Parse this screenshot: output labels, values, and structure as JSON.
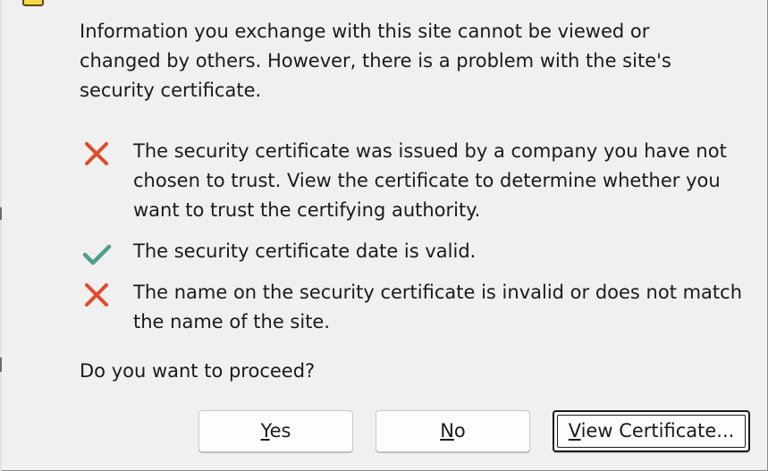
{
  "intro": {
    "text_line1": "Information you exchange with this site cannot be viewed or",
    "text_line2": "changed by others. However, there is a problem with the site's",
    "text_line3": "security certificate."
  },
  "items": [
    {
      "status": "fail",
      "icon": "red-x-icon",
      "line1": "The security certificate was issued by a company you have not",
      "line2": "chosen to trust. View the certificate to determine whether you",
      "line3": "want to trust the certifying authority."
    },
    {
      "status": "ok",
      "icon": "green-check-icon",
      "line1": "The security certificate date is valid."
    },
    {
      "status": "fail",
      "icon": "red-x-icon",
      "line1": "The name on the security certificate is invalid or does not match",
      "line2": "the name of the site."
    }
  ],
  "question": "Do you want to proceed?",
  "buttons": {
    "yes": {
      "mnemonic": "Y",
      "rest": "es"
    },
    "no": {
      "mnemonic": "N",
      "rest": "o"
    },
    "view": {
      "mnemonic": "V",
      "rest": "iew Certificate..."
    }
  },
  "colors": {
    "fail": "#e04a2a",
    "ok": "#4f9e8f",
    "background": "#f0f0f0"
  }
}
